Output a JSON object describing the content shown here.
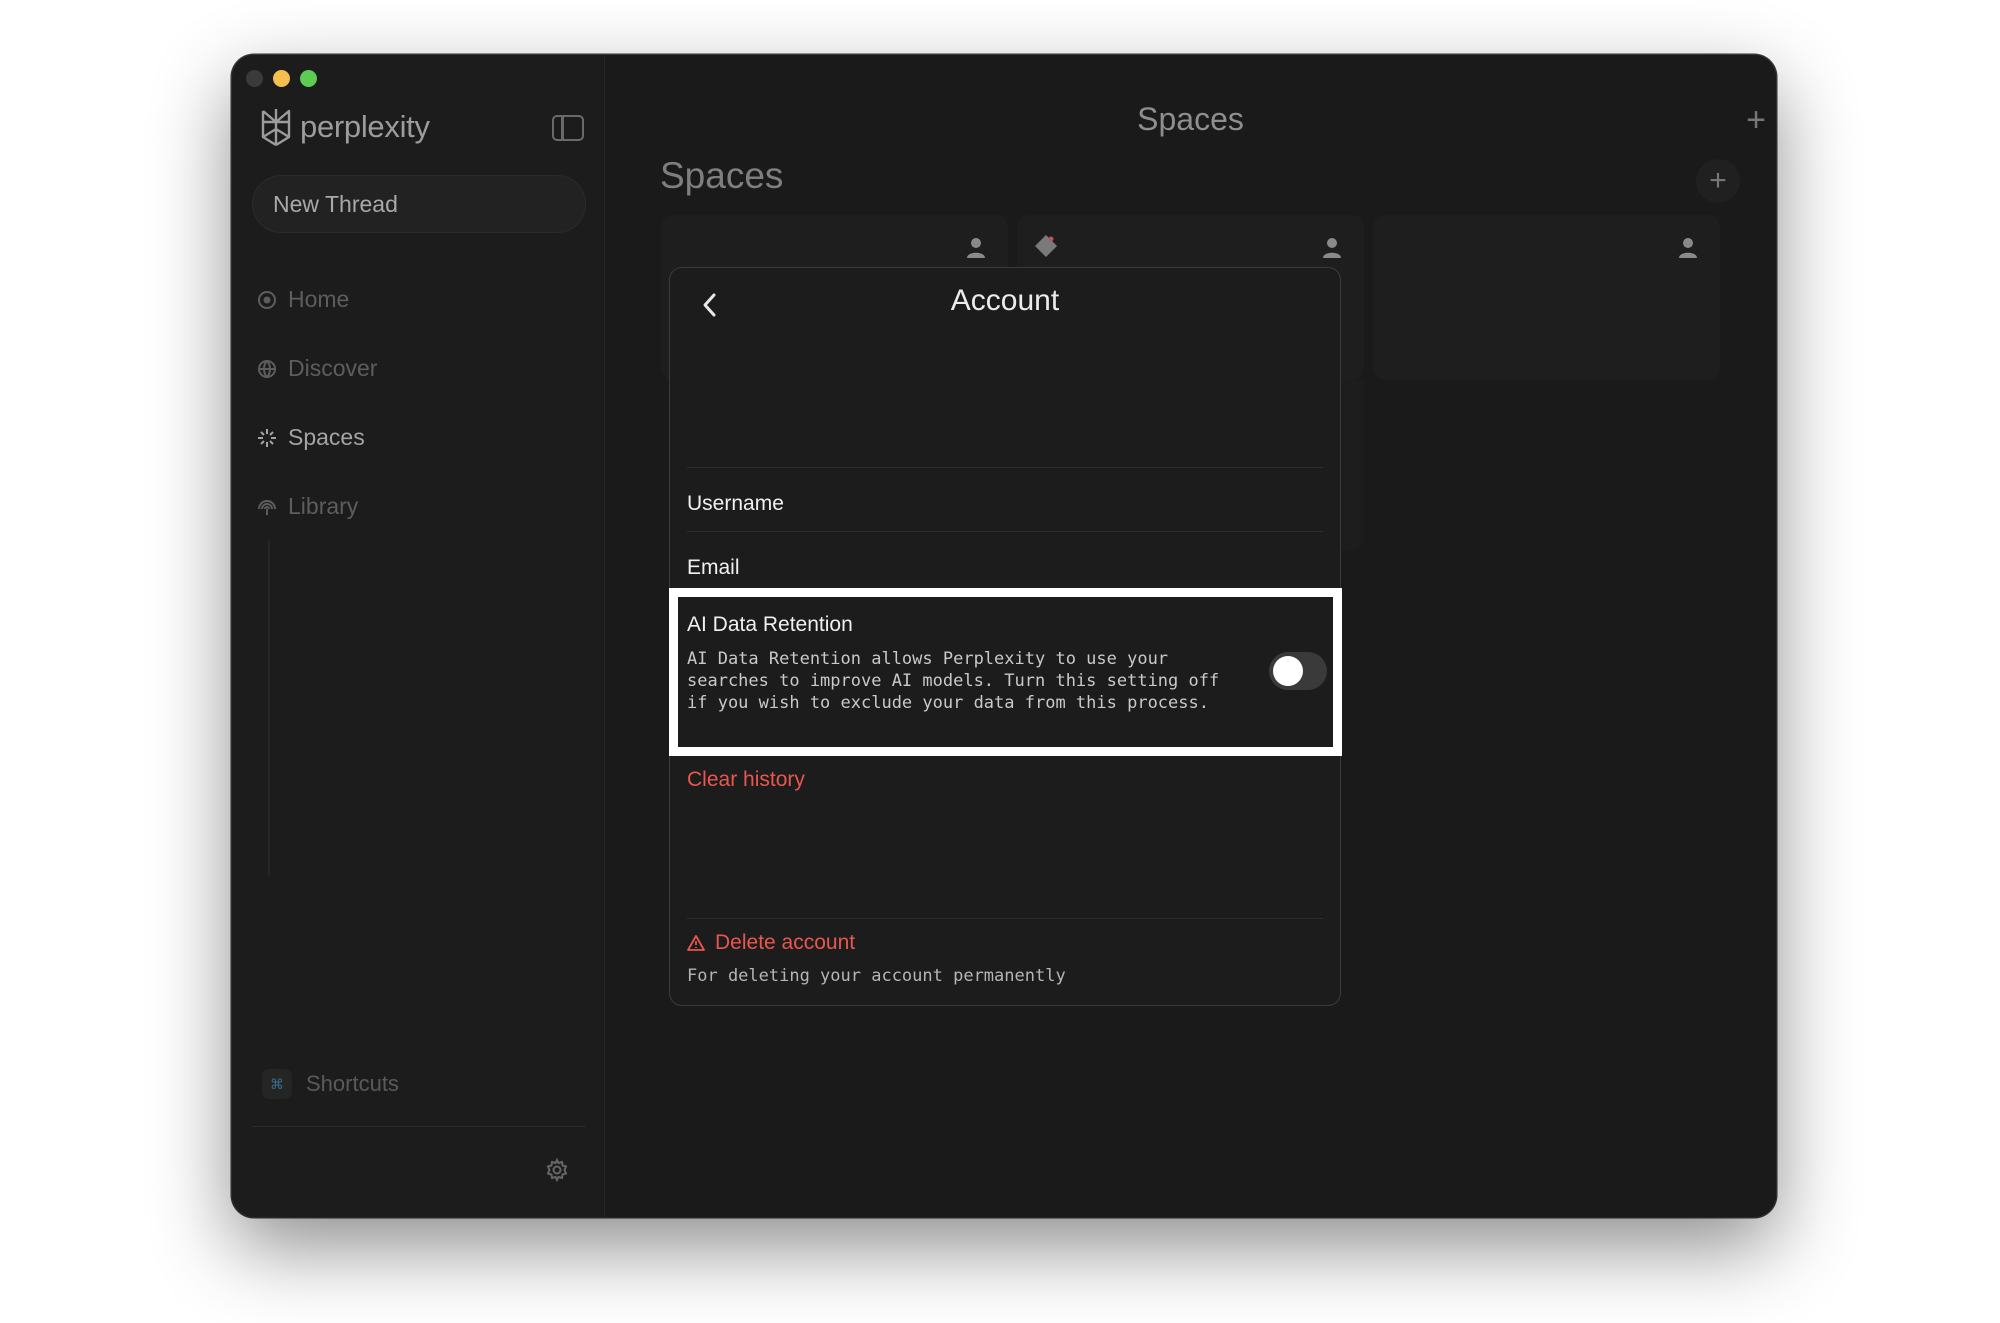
{
  "sidebar": {
    "brand": "perplexity",
    "new_thread_label": "New Thread",
    "nav": [
      {
        "label": "Home",
        "icon": "home-search-icon",
        "active": false
      },
      {
        "label": "Discover",
        "icon": "globe-icon",
        "active": false
      },
      {
        "label": "Spaces",
        "icon": "spaces-icon",
        "active": true
      },
      {
        "label": "Library",
        "icon": "library-icon",
        "active": false
      }
    ],
    "shortcuts_label": "Shortcuts",
    "shortcuts_key": "⌘"
  },
  "main": {
    "title": "Spaces",
    "heading": "Spaces",
    "add_symbol": "+"
  },
  "modal": {
    "title": "Account",
    "username_label": "Username",
    "email_label": "Email",
    "retention_title": "AI Data Retention",
    "retention_desc": "AI Data Retention allows Perplexity to use your searches to improve AI models. Turn this setting off if you wish to exclude your data from this process.",
    "retention_enabled": false,
    "clear_history_label": "Clear history",
    "delete_account_label": "Delete account",
    "delete_account_desc": "For deleting your account permanently"
  },
  "colors": {
    "danger": "#e8564e",
    "background": "#1b1b1b",
    "traffic_min": "#f5bf4f",
    "traffic_max": "#5ecb53"
  }
}
